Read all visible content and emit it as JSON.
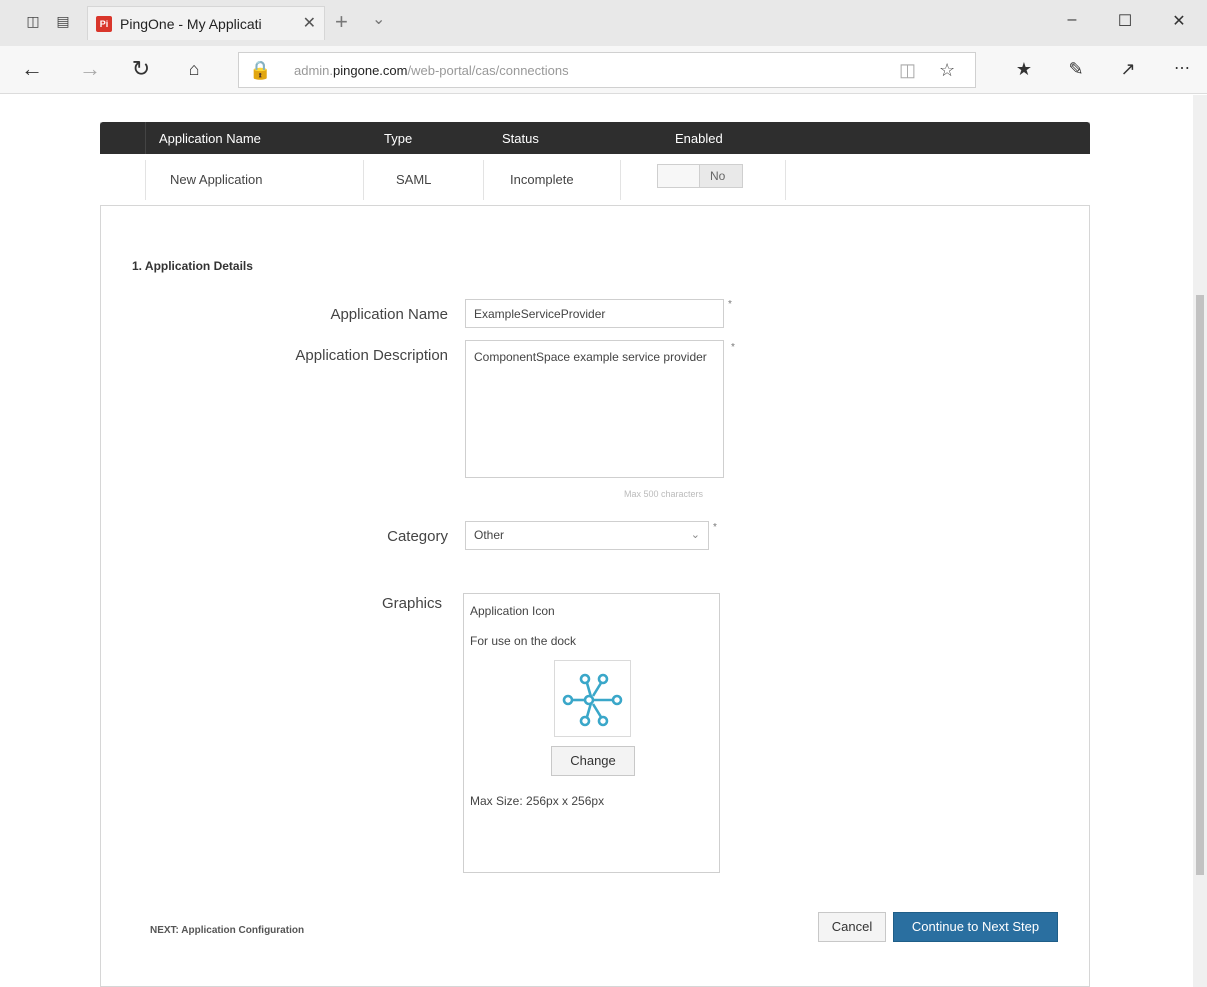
{
  "browser": {
    "tab_title": "PingOne - My Applicati",
    "tab_favicon_text": "Pi",
    "url_prefix": "admin.",
    "url_domain": "pingone.com",
    "url_path": "/web-portal/cas/connections"
  },
  "table": {
    "headers": [
      "Application Name",
      "Type",
      "Status",
      "Enabled"
    ],
    "row": {
      "name": "New Application",
      "type": "SAML",
      "status": "Incomplete",
      "enabled": "No"
    }
  },
  "form": {
    "section_title": "1. Application Details",
    "app_name_label": "Application Name",
    "app_name_value": "ExampleServiceProvider",
    "description_label": "Application Description",
    "description_value": "ComponentSpace example service provider",
    "description_hint": "Max 500 characters",
    "category_label": "Category",
    "category_value": "Other",
    "graphics_label": "Graphics",
    "graphics_title": "Application Icon",
    "graphics_subtitle": "For use on the dock",
    "change_label": "Change",
    "graphics_hint": "Max Size: 256px x 256px",
    "required_mark": "*"
  },
  "footer": {
    "next_label": "NEXT: Application Configuration",
    "cancel_label": "Cancel",
    "continue_label": "Continue to Next Step"
  },
  "colors": {
    "header_bg": "#2e2e2e",
    "primary_button": "#2a6fa0",
    "icon_accent": "#3aa7c9"
  }
}
